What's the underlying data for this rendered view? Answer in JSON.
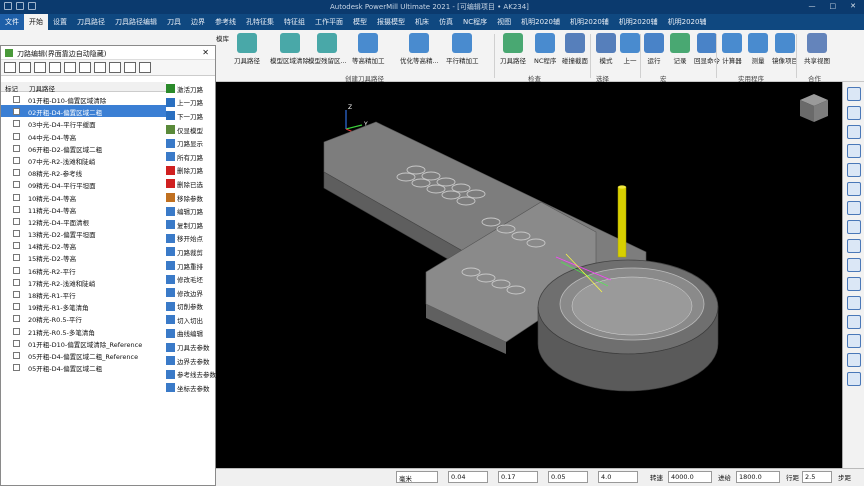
{
  "app": {
    "title": "Autodesk PowerMill Ultimate 2021 - [可编辑项目 • AK234]",
    "window_controls": [
      "—",
      "□",
      "✕"
    ]
  },
  "ribbon_tabs": [
    "文件",
    "开始",
    "设置",
    "刀具路径",
    "刀具路径编辑",
    "刀具",
    "边界",
    "参考线",
    "孔特征集",
    "特征组",
    "工作平面",
    "模型",
    "报摄模型",
    "机床",
    "仿真",
    "NC程序",
    "视图",
    "机明2020辅",
    "机明2020辅",
    "机明2020辅",
    "机明2020辅"
  ],
  "ribbon": {
    "buttons": [
      {
        "label": "刀具路径",
        "icon": "toolpath-icon"
      },
      {
        "label": "模型区域清除",
        "icon": "area-clear-icon"
      },
      {
        "label": "模型残留区...",
        "icon": "rest-clear-icon"
      },
      {
        "label": "等高精加工",
        "icon": "constant-z-icon"
      },
      {
        "label": "优化等高精...",
        "icon": "optimized-z-icon"
      },
      {
        "label": "平行精加工",
        "icon": "raster-finish-icon"
      },
      {
        "label": "刀具路径",
        "icon": "verify-toolpath-icon"
      },
      {
        "label": "NC程序",
        "icon": "nc-program-icon"
      },
      {
        "label": "碰撞截面",
        "icon": "collision-icon"
      },
      {
        "label": "模式",
        "icon": "mode-icon"
      },
      {
        "label": "上一",
        "icon": "select-previous-icon"
      },
      {
        "label": "运行",
        "icon": "run-macro-icon"
      },
      {
        "label": "记录",
        "icon": "record-icon"
      },
      {
        "label": "回显命令",
        "icon": "echo-icon"
      },
      {
        "label": "计算器",
        "icon": "calculator-icon"
      },
      {
        "label": "测量",
        "icon": "measure-icon"
      },
      {
        "label": "镜像项目",
        "icon": "mirror-icon"
      },
      {
        "label": "共享视图",
        "icon": "share-view-icon"
      }
    ],
    "groups": [
      "创建刀具路径",
      "检查",
      "选择",
      "宏",
      "实用程序",
      "合作"
    ],
    "left_cut": "模库"
  },
  "tree": {
    "title": "刀路编辑(界面靠边自动隐藏)",
    "columns": [
      "标记",
      "刀具路径"
    ],
    "items": [
      "01开粗-D10-偏置区域清除",
      "02开粗-D4-偏置区域二粗",
      "03中光-D4-平行平缓面",
      "04中光-D4-等高",
      "06开粗-D2-偏置区域二粗",
      "07中光-R2-浅滩和陡峭",
      "08精光-R2-参考线",
      "09精光-D4-平行平坦面",
      "10精光-D4-等高",
      "11精光-D4-等高",
      "12精光-D4-平面清根",
      "13精光-D2-偏置平坦面",
      "14精光-D2-等高",
      "15精光-D2-等高",
      "16精光-R2-平行",
      "17精光-R2-浅滩和陡峭",
      "18精光-R1-平行",
      "19精光-R1-多笔清角",
      "20精光-R0.5-平行",
      "21精光-R0.5-多笔清角",
      "01开粗-D10-偏置区域清除_Reference",
      "05开粗-D4-偏置区域二粗_Reference",
      "05开粗-D4-偏置区域二粗"
    ],
    "selected_index": 1,
    "actions": [
      {
        "label": "激活刀路",
        "color": "#2a8a2a"
      },
      {
        "label": "上一刀路",
        "color": "#2a6fc0"
      },
      {
        "label": "下一刀路",
        "color": "#2a6fc0"
      },
      {
        "label": "仅显模型",
        "color": "#5a8a3a"
      },
      {
        "label": "刀路显示",
        "color": "#3a7ac8"
      },
      {
        "label": "所有刀路",
        "color": "#3a7ac8"
      },
      {
        "label": "删除刀路",
        "color": "#d02020"
      },
      {
        "label": "删除已选",
        "color": "#d02020"
      },
      {
        "label": "移除参数",
        "color": "#c07020"
      },
      {
        "label": "编辑刀路",
        "color": "#3a7ac8"
      },
      {
        "label": "复制刀路",
        "color": "#3a7ac8"
      },
      {
        "label": "移开始点",
        "color": "#3a7ac8"
      },
      {
        "label": "刀路裁剪",
        "color": "#3a7ac8"
      },
      {
        "label": "刀路重排",
        "color": "#3a7ac8"
      },
      {
        "label": "修改毛坯",
        "color": "#3a7ac8"
      },
      {
        "label": "修改边界",
        "color": "#3a7ac8"
      },
      {
        "label": "切削参数",
        "color": "#3a7ac8"
      },
      {
        "label": "切入切出",
        "color": "#3a7ac8"
      },
      {
        "label": "曲线编辑",
        "color": "#3a7ac8"
      },
      {
        "label": "刀具去参数",
        "color": "#3a7ac8"
      },
      {
        "label": "边界去参数",
        "color": "#3a7ac8"
      },
      {
        "label": "参考线去参数",
        "color": "#3a7ac8"
      },
      {
        "label": "坐标去参数",
        "color": "#3a7ac8"
      }
    ]
  },
  "status": {
    "unit": "毫米",
    "tolerance": "0.04",
    "stock": "0.17",
    "thickness": "0.05",
    "value4": "4.0",
    "speed_label": "转速",
    "speed": "4000.0",
    "feed_label": "进给",
    "feed": "1800.0",
    "stepover_label": "行距",
    "stepover": "2.5",
    "stepdown_label": "步距"
  },
  "axes": {
    "x": "X",
    "y": "Y",
    "z": "Z"
  },
  "colors": {
    "title_bar": "#0b3a6e",
    "tab_bar": "#0f4880",
    "selected": "#3b7fd4",
    "viewport": "#000000",
    "model": "#8c8c8c",
    "tool": "#d8d000"
  }
}
